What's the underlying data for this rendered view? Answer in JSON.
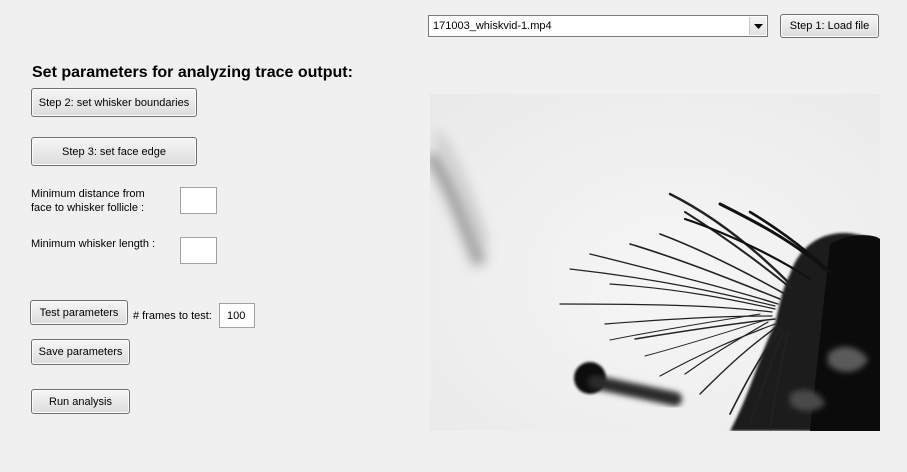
{
  "file_select": {
    "value": "171003_whiskvid-1.mp4"
  },
  "buttons": {
    "load_file": "Step 1: Load file",
    "set_whisker_boundaries": "Step 2: set whisker boundaries",
    "set_face_edge": "Step 3: set face edge",
    "test_parameters": "Test parameters",
    "save_parameters": "Save parameters",
    "run_analysis": "Run analysis"
  },
  "heading": "Set parameters for analyzing trace output:",
  "fields": {
    "min_distance": {
      "label_line1": "Minimum distance from",
      "label_line2": "face to whisker follicle :",
      "value": ""
    },
    "min_length": {
      "label": "Minimum whisker length :",
      "value": ""
    },
    "frames_to_test": {
      "label": "# frames to test:",
      "value": "100"
    }
  }
}
